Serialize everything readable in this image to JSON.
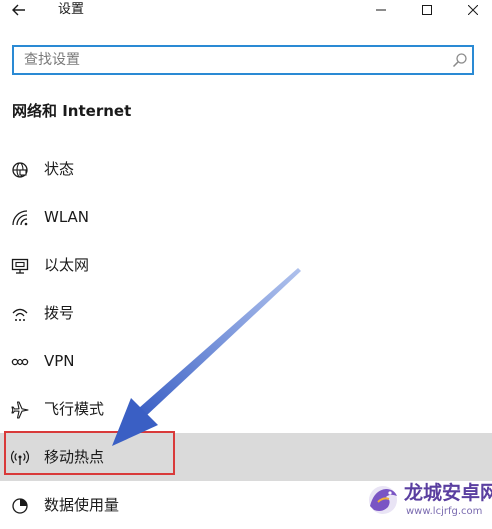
{
  "window": {
    "title": "设置",
    "back_icon": "arrow-left-icon",
    "minimize_icon": "minimize-icon",
    "maximize_icon": "maximize-icon",
    "close_icon": "close-icon"
  },
  "search": {
    "placeholder": "查找设置",
    "value": "",
    "icon": "search-icon"
  },
  "section": {
    "title": "网络和 Internet"
  },
  "nav": {
    "items": [
      {
        "label": "状态",
        "icon": "globe-icon",
        "selected": false
      },
      {
        "label": "WLAN",
        "icon": "wifi-icon",
        "selected": false
      },
      {
        "label": "以太网",
        "icon": "ethernet-icon",
        "selected": false
      },
      {
        "label": "拨号",
        "icon": "dialup-icon",
        "selected": false
      },
      {
        "label": "VPN",
        "icon": "vpn-icon",
        "selected": false
      },
      {
        "label": "飞行模式",
        "icon": "airplane-icon",
        "selected": false
      },
      {
        "label": "移动热点",
        "icon": "hotspot-icon",
        "selected": true
      },
      {
        "label": "数据使用量",
        "icon": "data-usage-icon",
        "selected": false
      }
    ]
  },
  "annotation": {
    "highlight_color": "#d93a3a",
    "arrow_color": "#3a5fc4"
  },
  "watermark": {
    "name": "龙城安卓网",
    "url": "www.lcjrfg.com"
  },
  "colors": {
    "accent": "#2a8ad4",
    "selected_bg": "#dadada",
    "text": "#1a1a1a"
  }
}
